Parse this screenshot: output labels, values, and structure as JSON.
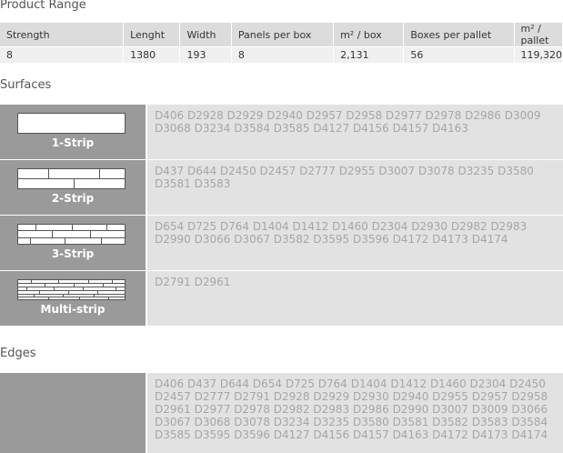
{
  "product_range": {
    "title": "Product Range",
    "headers": [
      "Strength",
      "Lenght",
      "Width",
      "Panels per box",
      "m² / box",
      "Boxes per pallet",
      "m² / pallet"
    ],
    "rows": [
      [
        "8",
        "1380",
        "193",
        "8",
        "2,131",
        "56",
        "119,320"
      ]
    ]
  },
  "surfaces": {
    "title": "Surfaces",
    "items": [
      {
        "label": "1-Strip",
        "codes": "D406 D2928 D2929 D2940 D2957 D2958 D2977 D2978 D2986 D3009 D3068 D3234 D3584 D3585 D4127 D4156 D4157 D4163"
      },
      {
        "label": "2-Strip",
        "codes": "D437 D644 D2450 D2457 D2777 D2955 D3007 D3078 D3235 D3580 D3581 D3583"
      },
      {
        "label": "3-Strip",
        "codes": "D654 D725 D764 D1404 D1412 D1460 D2304 D2930 D2982 D2983 D2990 D3066 D3067 D3582 D3595 D3596 D4172 D4173 D4174"
      },
      {
        "label": "Multi-strip",
        "codes": "D2791 D2961"
      }
    ]
  },
  "edges": {
    "title": "Edges",
    "codes": "D406 D437 D644 D654 D725 D764 D1404 D1412 D1460 D2304 D2450 D2457 D2777 D2791 D2928 D2929 D2930 D2940 D2955 D2957 D2958 D2961 D2977 D2978 D2982 D2983 D2986 D2990 D3007 D3009 D3066 D3067 D3068 D3078 D3234 D3235 D3580 D3581 D3582 D3583 D3584 D3585 D3595 D3596 D4127 D4156 D4157 D4163 D4172 D4173 D4174"
  }
}
